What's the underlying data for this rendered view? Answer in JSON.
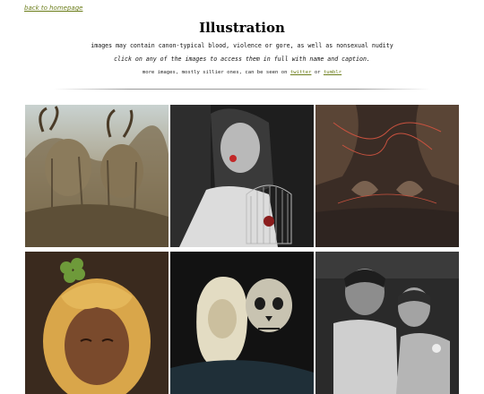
{
  "nav": {
    "back_label": "back to homepage"
  },
  "page": {
    "title": "Illustration",
    "warning": "images may contain canon-typical blood, violence or gore, as well as nonsexual nudity",
    "instruction": "click on any of the images to access them in full with name and caption.",
    "more_prefix": "more images, mostly sillier ones, can be seen on",
    "more_twitter": "twitter",
    "more_or": "or",
    "more_tumblr": "tumblr"
  },
  "colors": {
    "link": "#6b7d1a"
  },
  "gallery": [
    {
      "name": "thumb-horned-figures",
      "alt": ""
    },
    {
      "name": "thumb-birdcage",
      "alt": ""
    },
    {
      "name": "thumb-red-string-hands",
      "alt": ""
    },
    {
      "name": "thumb-clover-portrait",
      "alt": ""
    },
    {
      "name": "thumb-skull",
      "alt": ""
    },
    {
      "name": "thumb-two-men",
      "alt": ""
    }
  ]
}
